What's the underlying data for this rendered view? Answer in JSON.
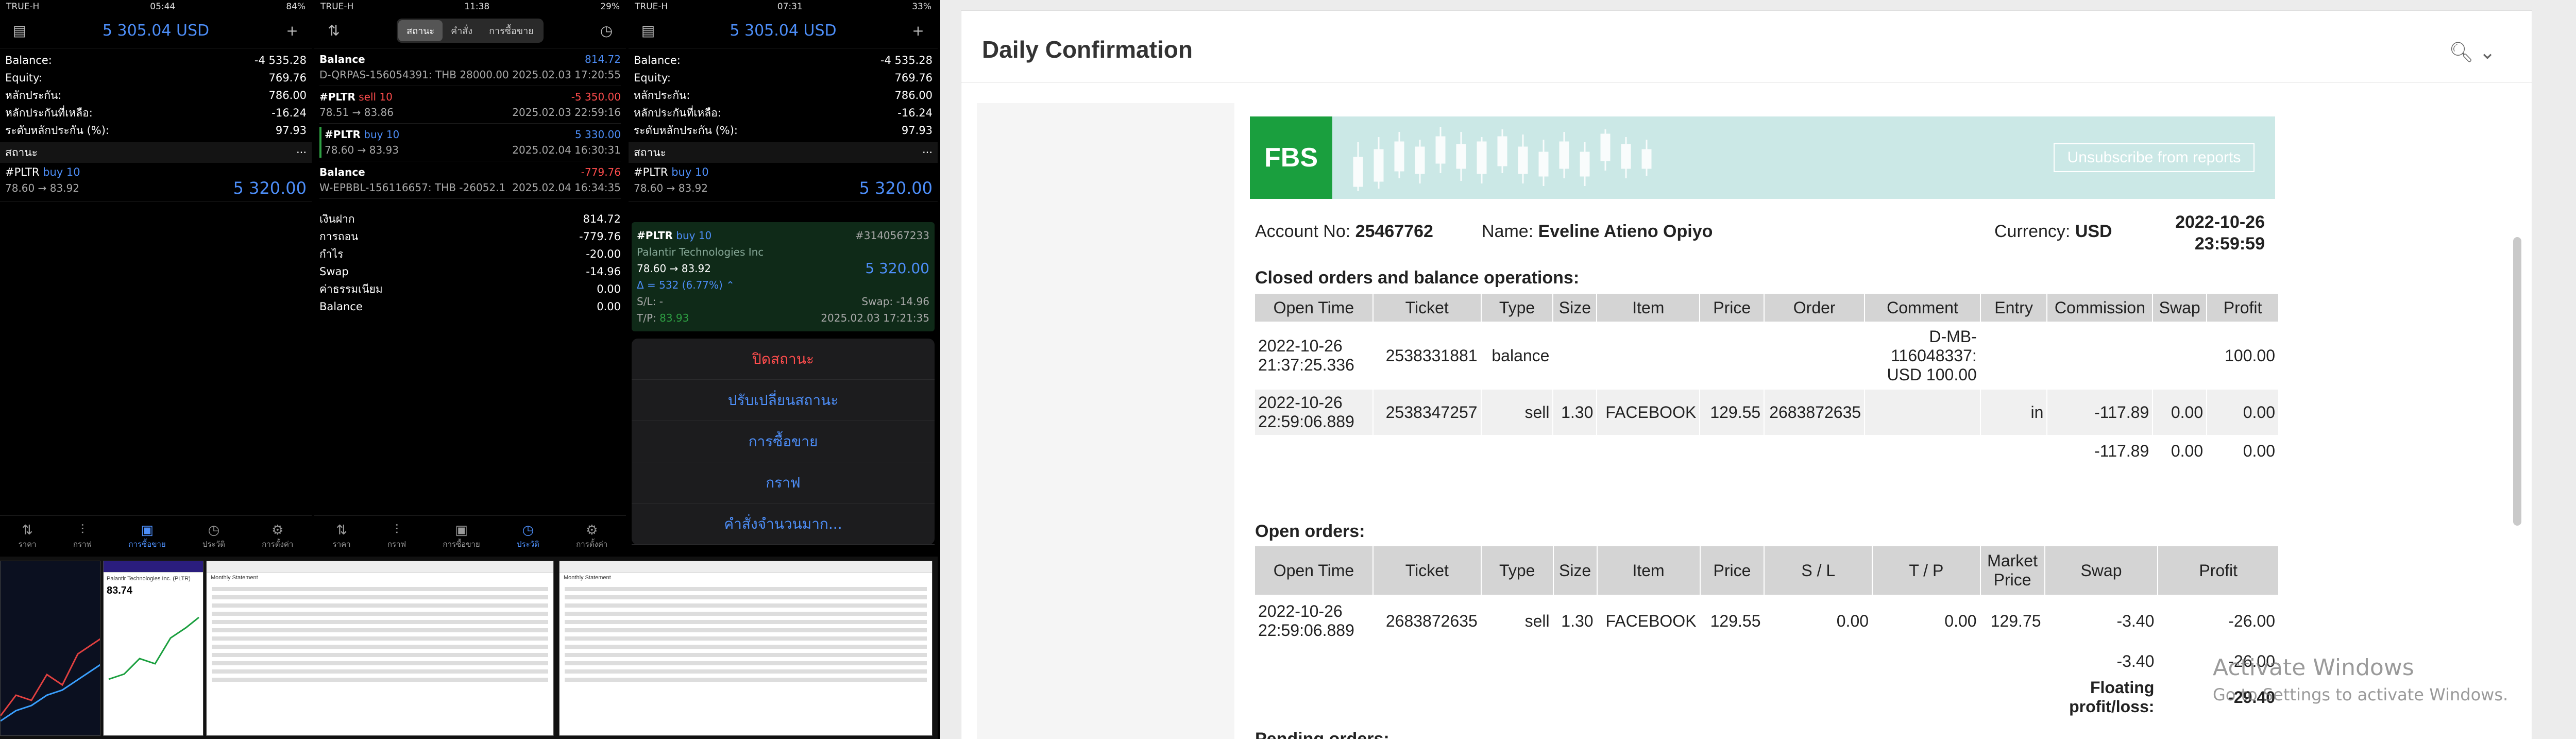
{
  "phone1": {
    "status": {
      "left": "TRUE-H",
      "time": "05:44",
      "right": "84%"
    },
    "balance_header": "5 305.04 USD",
    "metrics": [
      {
        "label": "Balance:",
        "value": "-4 535.28"
      },
      {
        "label": "Equity:",
        "value": "769.76"
      },
      {
        "label": "หลักประกัน:",
        "value": "786.00"
      },
      {
        "label": "หลักประกันที่เหลือ:",
        "value": "-16.24"
      },
      {
        "label": "ระดับหลักประกัน (%):",
        "value": "97.93"
      }
    ],
    "section": "สถานะ",
    "position": {
      "symbol": "#PLTR",
      "side": "buy 10",
      "prices": "78.60 → 83.92",
      "profit": "5 320.00"
    },
    "tabs": [
      "ราคา",
      "กราฟ",
      "การซื้อขาย",
      "ประวัติ",
      "การตั้งค่า"
    ]
  },
  "phone2": {
    "status": {
      "left": "TRUE-H",
      "time": "11:38",
      "right": "29%"
    },
    "segments": [
      "สถานะ",
      "คำสั่ง",
      "การซื้อขาย"
    ],
    "items": [
      {
        "title": "Balance",
        "title_color": "white",
        "value": "814.72",
        "value_color": "blue",
        "sub": "D-QRPAS-156054391: THB 28000.00",
        "time": "2025.02.03 17:20:55"
      },
      {
        "title": "#PLTR",
        "side": "sell 10",
        "side_color": "red",
        "value": "-5 350.00",
        "value_color": "red",
        "sub": "78.51 → 83.86",
        "time": "2025.02.03 22:59:16"
      },
      {
        "title": "#PLTR",
        "side": "buy 10",
        "side_color": "blue",
        "value": "5 330.00",
        "value_color": "blue",
        "sub": "78.60 → 83.93",
        "time": "2025.02.04 16:30:31"
      },
      {
        "title": "Balance",
        "title_color": "white",
        "value": "-779.76",
        "value_color": "red",
        "sub": "W-EPBBL-156116657: THB -26052.1",
        "time": "2025.02.04 16:34:35"
      }
    ],
    "summary": [
      {
        "label": "เงินฝาก",
        "value": "814.72"
      },
      {
        "label": "การถอน",
        "value": "-779.76"
      },
      {
        "label": "กำไร",
        "value": "-20.00"
      },
      {
        "label": "Swap",
        "value": "-14.96"
      },
      {
        "label": "ค่าธรรมเนียม",
        "value": "0.00"
      },
      {
        "label": "Balance",
        "value": "0.00"
      }
    ],
    "tabs": [
      "ราคา",
      "กราฟ",
      "การซื้อขาย",
      "ประวัติ",
      "การตั้งค่า"
    ]
  },
  "phone3": {
    "status": {
      "left": "TRUE-H",
      "time": "07:31",
      "right": "33%"
    },
    "balance_header": "5 305.04 USD",
    "metrics": [
      {
        "label": "Balance:",
        "value": "-4 535.28"
      },
      {
        "label": "Equity:",
        "value": "769.76"
      },
      {
        "label": "หลักประกัน:",
        "value": "786.00"
      },
      {
        "label": "หลักประกันที่เหลือ:",
        "value": "-16.24"
      },
      {
        "label": "ระดับหลักประกัน (%):",
        "value": "97.93"
      }
    ],
    "section": "สถานะ",
    "position": {
      "symbol": "#PLTR",
      "side": "buy 10",
      "prices": "78.60 → 83.92",
      "profit": "5 320.00"
    },
    "detail": {
      "symbol": "#PLTR",
      "side": "buy 10",
      "order": "#3140567233",
      "company": "Palantir Technologies Inc",
      "prices": "78.60 → 83.92",
      "profit": "5 320.00",
      "change": "Δ = 532 (6.77%) ⌃",
      "sl_label": "S/L:",
      "sl_value": "-",
      "swap_label": "Swap:",
      "swap_value": "-14.96",
      "tp_label": "T/P:",
      "tp_value": "83.93",
      "time": "2025.02.03 17:21:35"
    },
    "sheet": [
      "ปิดสถานะ",
      "ปรับเปลี่ยนสถานะ",
      "การซื้อขาย",
      "กราฟ",
      "คำสั่งจำนวนมาก..."
    ]
  },
  "thumbs": {
    "chart_title": "Palantir Technologies Inc. (PLTR)",
    "price": "83.74",
    "statement": "Monthly Statement"
  },
  "report": {
    "window_title": "Daily Confirmation",
    "unsubscribe": "Unsubscribe from reports",
    "logo": "FBS",
    "account_label": "Account No:",
    "account_no": "25467762",
    "name_label": "Name:",
    "name": "Eveline Atieno Opiyo",
    "currency_label": "Currency:",
    "currency": "USD",
    "date": "2022-10-26",
    "time": "23:59:59",
    "closed_title": "Closed orders and balance operations:",
    "closed_headers": [
      "Open Time",
      "Ticket",
      "Type",
      "Size",
      "Item",
      "Price",
      "Order",
      "Comment",
      "Entry",
      "Commission",
      "Swap",
      "Profit"
    ],
    "closed_rows": [
      [
        "2022-10-26 21:37:25.336",
        "2538331881",
        "balance",
        "",
        "",
        "",
        "",
        "D-MB-116048337: USD 100.00",
        "",
        "",
        "",
        "100.00"
      ],
      [
        "2022-10-26 22:59:06.889",
        "2538347257",
        "sell",
        "1.30",
        "FACEBOOK",
        "129.55",
        "2683872635",
        "",
        "in",
        "-117.89",
        "0.00",
        "0.00"
      ]
    ],
    "closed_totals": [
      "-117.89",
      "0.00",
      "0.00"
    ],
    "open_title": "Open orders:",
    "open_headers": [
      "Open Time",
      "Ticket",
      "Type",
      "Size",
      "Item",
      "Price",
      "S / L",
      "T / P",
      "Market Price",
      "Swap",
      "Profit"
    ],
    "open_rows": [
      [
        "2022-10-26 22:59:06.889",
        "2683872635",
        "sell",
        "1.30",
        "FACEBOOK",
        "129.55",
        "0.00",
        "0.00",
        "129.75",
        "-3.40",
        "-26.00"
      ]
    ],
    "open_totals": [
      "-3.40",
      "-26.00"
    ],
    "floating_label": "Floating profit/loss:",
    "floating_value": "-29.40",
    "pending_title": "Pending orders:"
  },
  "watermark": {
    "line1": "Activate Windows",
    "line2": "Go to Settings to activate Windows."
  },
  "colors": {
    "accent_blue": "#4d8ef8",
    "loss_red": "#ff4d4d",
    "fbs_green": "#1a9f3e",
    "banner_teal": "#cbe8e6"
  }
}
